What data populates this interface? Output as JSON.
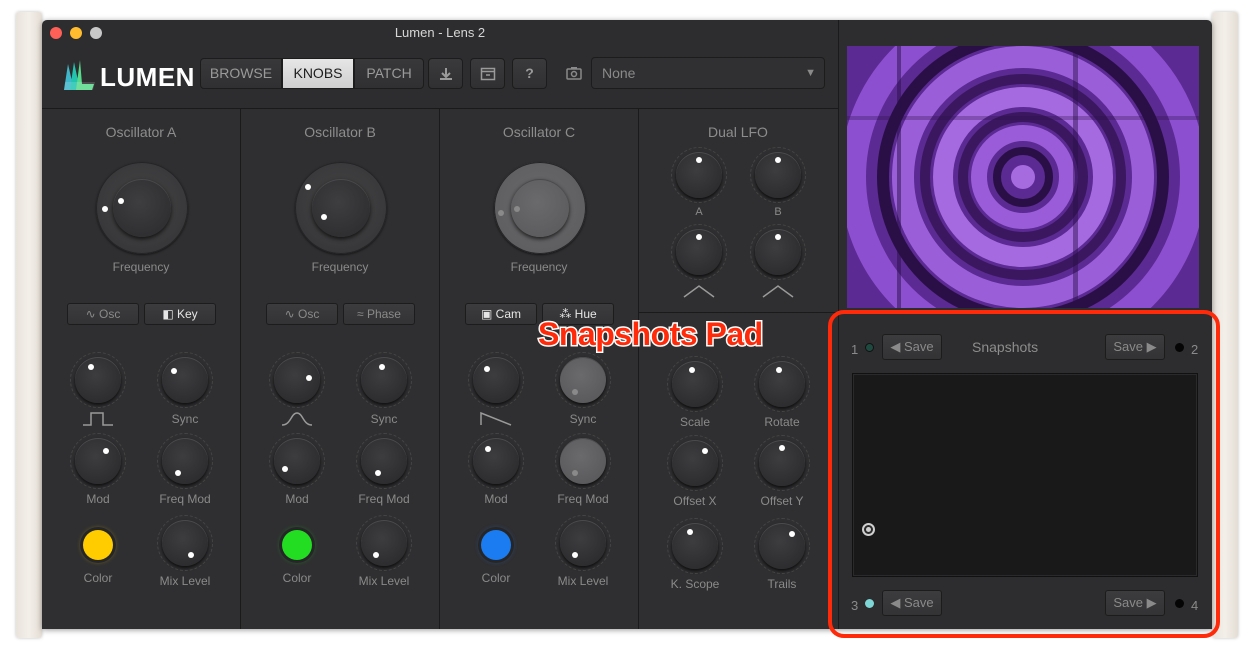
{
  "window": {
    "title": "Lumen - Lens 2"
  },
  "logo": {
    "text": "LUMEN"
  },
  "toolbar": {
    "tabs": [
      {
        "label": "BROWSE"
      },
      {
        "label": "KNOBS"
      },
      {
        "label": "PATCH"
      }
    ],
    "active_tab": "KNOBS",
    "preset_value": "None",
    "icons": [
      "download-icon",
      "window-icon",
      "help-icon",
      "camera-icon"
    ],
    "help_label": "?"
  },
  "oscA": {
    "title": "Oscillator A",
    "freq_label": "Frequency",
    "btn1": "Osc",
    "btn2": "Key",
    "k1": "",
    "k2": "Sync",
    "k3": "Mod",
    "k4": "Freq Mod",
    "color_label": "Color",
    "mix_label": "Mix Level",
    "color": "#ffcc00"
  },
  "oscB": {
    "title": "Oscillator B",
    "freq_label": "Frequency",
    "btn1": "Osc",
    "btn2": "Phase",
    "k1": "",
    "k2": "Sync",
    "k3": "Mod",
    "k4": "Freq Mod",
    "color_label": "Color",
    "mix_label": "Mix Level",
    "color": "#22dd22"
  },
  "oscC": {
    "title": "Oscillator C",
    "freq_label": "Frequency",
    "btn1": "Cam",
    "btn2": "Hue",
    "k1": "",
    "k2": "Sync",
    "k3": "Mod",
    "k4": "Freq Mod",
    "color_label": "Color",
    "mix_label": "Mix Level",
    "color": "#1a7cf0"
  },
  "lfo": {
    "title": "Dual LFO",
    "a": "A",
    "b": "B"
  },
  "transform": {
    "scale": "Scale",
    "rotate": "Rotate",
    "offx": "Offset X",
    "offy": "Offset Y",
    "kscope": "K. Scope",
    "trails": "Trails"
  },
  "snapshots": {
    "title": "Snapshots",
    "save": "Save",
    "n1": "1",
    "n2": "2",
    "n3": "3",
    "n4": "4"
  },
  "annotation": {
    "text": "Snapshots Pad",
    "color": "#ff2a0a"
  }
}
